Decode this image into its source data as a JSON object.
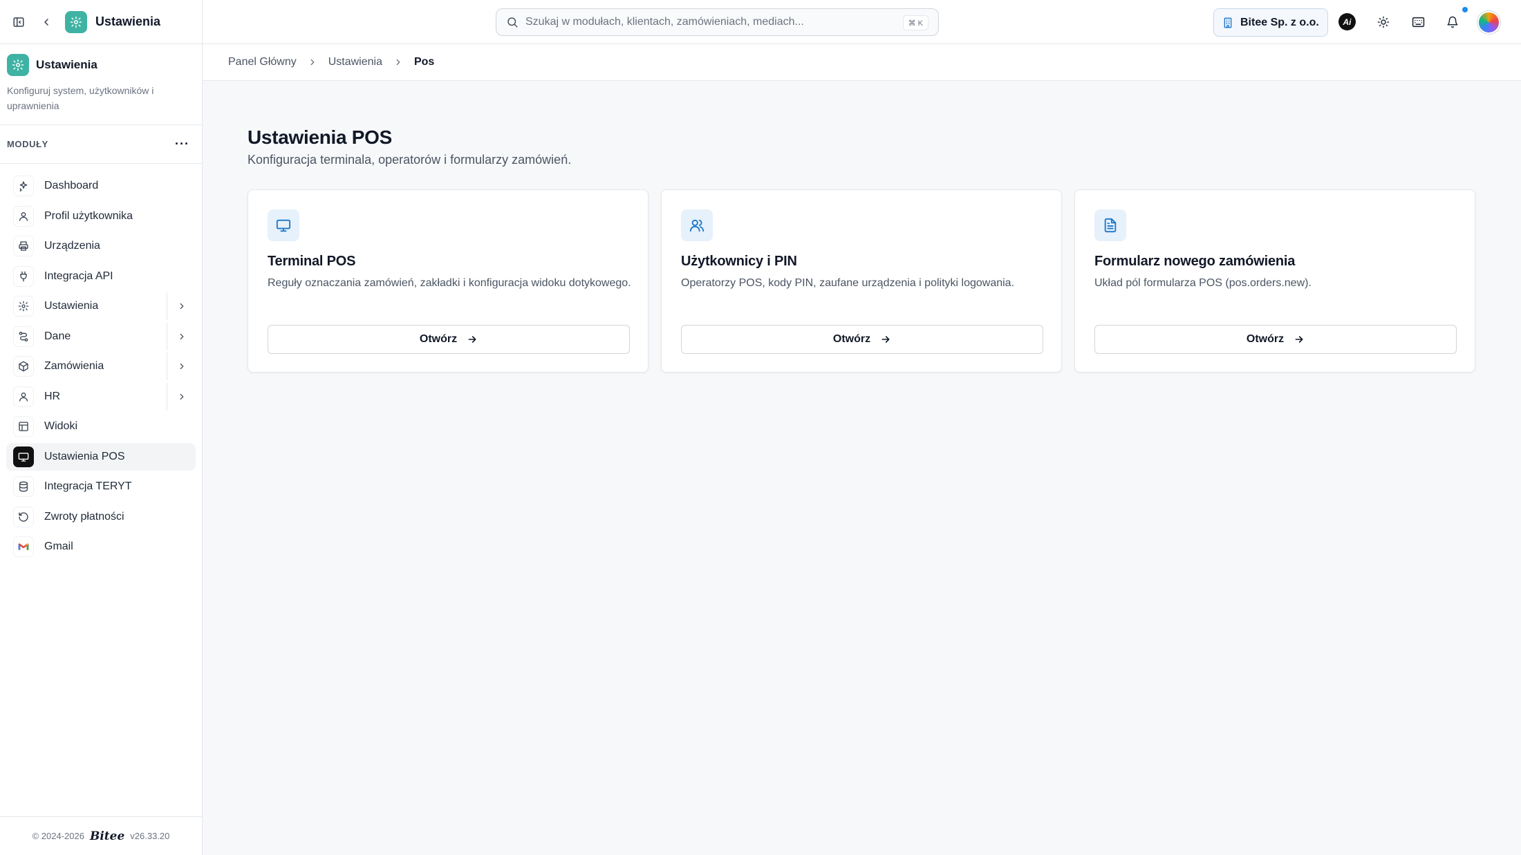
{
  "app": {
    "title": "Ustawienia"
  },
  "sidebar": {
    "header_title": "Ustawienia",
    "header_desc": "Konfiguruj system, użytkowników i uprawnienia",
    "modules_label": "MODUŁY",
    "items": [
      {
        "label": "Dashboard",
        "icon": "sparkles-icon"
      },
      {
        "label": "Profil użytkownika",
        "icon": "user-icon"
      },
      {
        "label": "Urządzenia",
        "icon": "printer-icon"
      },
      {
        "label": "Integracja API",
        "icon": "plug-icon"
      },
      {
        "label": "Ustawienia",
        "icon": "gear-icon",
        "expandable": true
      },
      {
        "label": "Dane",
        "icon": "route-icon",
        "expandable": true
      },
      {
        "label": "Zamówienia",
        "icon": "package-icon",
        "expandable": true
      },
      {
        "label": "HR",
        "icon": "user-icon",
        "expandable": true
      },
      {
        "label": "Widoki",
        "icon": "layout-icon"
      },
      {
        "label": "Ustawienia POS",
        "icon": "monitor-icon",
        "active": true
      },
      {
        "label": "Integracja TERYT",
        "icon": "database-icon"
      },
      {
        "label": "Zwroty płatności",
        "icon": "rotate-ccw-icon"
      },
      {
        "label": "Gmail",
        "icon": "gmail-icon"
      }
    ],
    "footer": {
      "copyright": "© 2024-2026",
      "brand": "Bitee",
      "version": "v26.33.20"
    }
  },
  "topbar": {
    "search_placeholder": "Szukaj w modułach, klientach, zamówieniach, mediach...",
    "search_shortcut": "⌘ K",
    "company": "Bitee Sp. z o.o.",
    "ai_label": "Ai"
  },
  "breadcrumb": {
    "items": [
      "Panel Główny",
      "Ustawienia"
    ],
    "current": "Pos"
  },
  "main": {
    "title": "Ustawienia POS",
    "subtitle": "Konfiguracja terminala, operatorów i formularzy zamówień.",
    "cards": [
      {
        "title": "Terminal POS",
        "desc": "Reguły oznaczania zamówień, zakładki i konfiguracja widoku dotykowego.",
        "button": "Otwórz",
        "icon": "monitor-icon"
      },
      {
        "title": "Użytkownicy i PIN",
        "desc": "Operatorzy POS, kody PIN, zaufane urządzenia i polityki logowania.",
        "button": "Otwórz",
        "icon": "users-icon"
      },
      {
        "title": "Formularz nowego zamówienia",
        "desc": "Układ pól formularza POS (pos.orders.new).",
        "button": "Otwórz",
        "icon": "file-text-icon"
      }
    ]
  },
  "colors": {
    "accent": "#3fb3a3",
    "card_icon_bg": "#e6f1fb",
    "card_icon_fg": "#1b75c9",
    "notification_dot": "#1d8cf0"
  }
}
